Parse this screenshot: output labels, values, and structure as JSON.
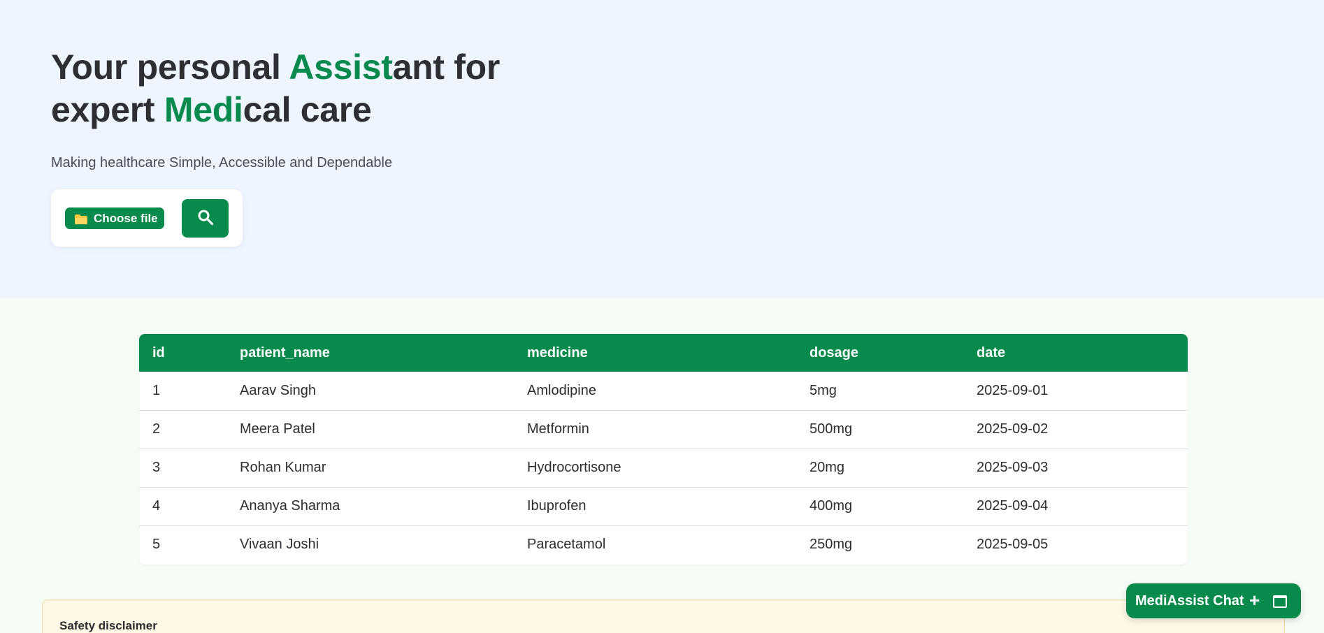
{
  "hero": {
    "title_line1_pre": "Your personal ",
    "title_line1_accent": "Assist",
    "title_line1_post": "ant for",
    "title_line2_pre": "expert ",
    "title_line2_accent": "Medi",
    "title_line2_post": "cal care",
    "subtitle": "Making healthcare Simple, Accessible and Dependable"
  },
  "upload": {
    "choose_label": "Choose file",
    "folder_icon": "folder-icon",
    "search_icon": "search-icon"
  },
  "table": {
    "columns": [
      "id",
      "patient_name",
      "medicine",
      "dosage",
      "date"
    ],
    "rows": [
      [
        "1",
        "Aarav Singh",
        "Amlodipine",
        "5mg",
        "2025-09-01"
      ],
      [
        "2",
        "Meera Patel",
        "Metformin",
        "500mg",
        "2025-09-02"
      ],
      [
        "3",
        "Rohan Kumar",
        "Hydrocortisone",
        "20mg",
        "2025-09-03"
      ],
      [
        "4",
        "Ananya Sharma",
        "Ibuprofen",
        "400mg",
        "2025-09-04"
      ],
      [
        "5",
        "Vivaan Joshi",
        "Paracetamol",
        "250mg",
        "2025-09-05"
      ]
    ]
  },
  "disclaimer": {
    "title": "Safety disclaimer"
  },
  "chat": {
    "label": "MediAssist Chat",
    "plus": "+"
  },
  "colors": {
    "brand_green": "#078a4c",
    "hero_bg": "#eef5ff",
    "page_bg": "#f6fdf7",
    "disclaimer_bg": "#fff8e6"
  }
}
